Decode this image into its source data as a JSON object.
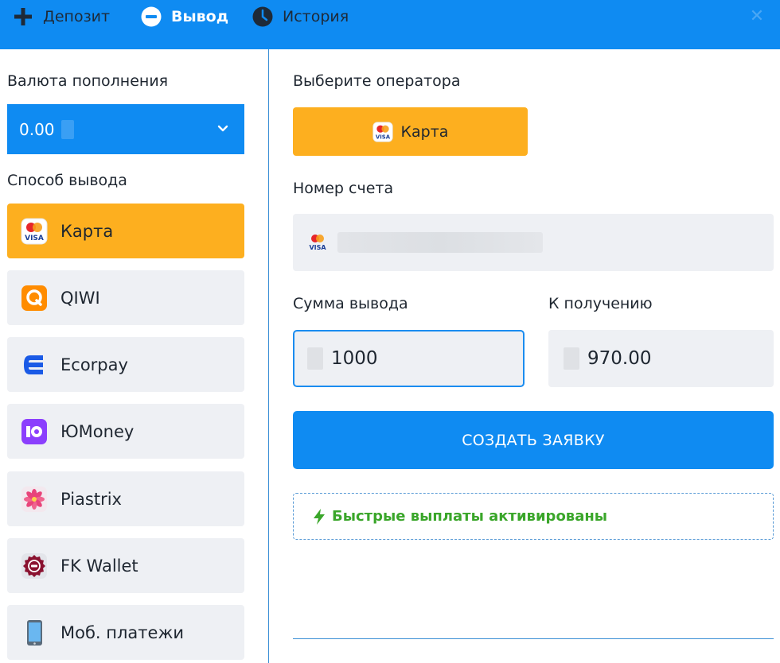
{
  "nav": {
    "deposit_label": "Депозит",
    "withdraw_label": "Вывод",
    "history_label": "История",
    "active_tab": "withdraw"
  },
  "left": {
    "currency_label": "Валюта пополнения",
    "currency_value": "0.00",
    "method_label": "Способ вывода",
    "methods": [
      {
        "label": "Карта",
        "icon": "mastercard-visa-icon",
        "selected": true
      },
      {
        "label": "QIWI",
        "icon": "qiwi-icon",
        "selected": false
      },
      {
        "label": "Ecorpay",
        "icon": "ecorpay-icon",
        "selected": false
      },
      {
        "label": "ЮMoney",
        "icon": "yoomoney-icon",
        "selected": false
      },
      {
        "label": "Piastrix",
        "icon": "piastrix-icon",
        "selected": false
      },
      {
        "label": "FK Wallet",
        "icon": "fk-wallet-icon",
        "selected": false
      },
      {
        "label": "Моб. платежи",
        "icon": "mobile-phone-icon",
        "selected": false
      }
    ]
  },
  "right": {
    "operator_label": "Выберите оператора",
    "operator_button": "Карта",
    "account_label": "Номер счета",
    "amount_label": "Сумма вывода",
    "amount_value": "1000",
    "receive_label": "К получению",
    "receive_value": "970.00",
    "submit_label": "СОЗДАТЬ ЗАЯВКУ",
    "fast_payouts": "Быстрые выплаты активированы"
  },
  "colors": {
    "brand_blue": "#0f8bf2",
    "selected_orange": "#fdaf1f",
    "field_bg": "#eef0f4",
    "success_green": "#3aa62a"
  }
}
